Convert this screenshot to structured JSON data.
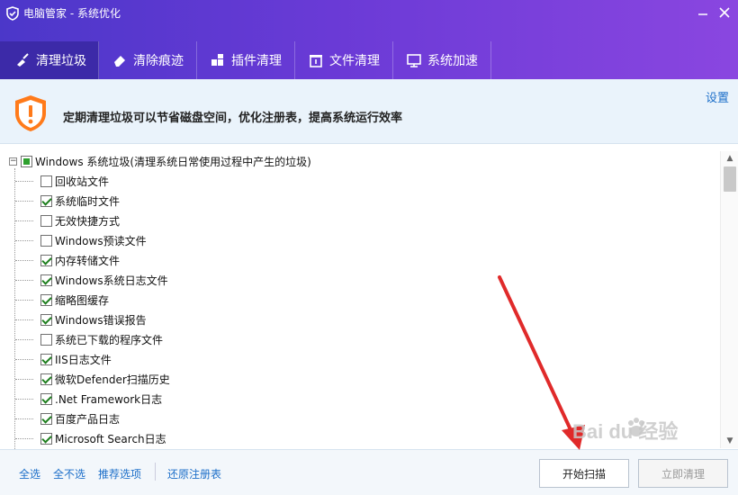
{
  "window": {
    "title": "电脑管家 - 系统优化"
  },
  "tabs": [
    {
      "label": "清理垃圾",
      "icon": "broom-icon",
      "active": true
    },
    {
      "label": "清除痕迹",
      "icon": "eraser-icon",
      "active": false
    },
    {
      "label": "插件清理",
      "icon": "puzzle-icon",
      "active": false
    },
    {
      "label": "文件清理",
      "icon": "file-box-icon",
      "active": false
    },
    {
      "label": "系统加速",
      "icon": "monitor-icon",
      "active": false
    }
  ],
  "banner": {
    "message": "定期清理垃圾可以节省磁盘空间，优化注册表，提高系统运行效率",
    "settings_label": "设置",
    "icon": "warning-shield-icon"
  },
  "tree": {
    "root": {
      "label": "Windows 系统垃圾(清理系统日常使用过程中产生的垃圾)",
      "state": "partial",
      "expanded": true
    },
    "items": [
      {
        "label": "回收站文件",
        "checked": false
      },
      {
        "label": "系统临时文件",
        "checked": true
      },
      {
        "label": "无效快捷方式",
        "checked": false
      },
      {
        "label": "Windows预读文件",
        "checked": false
      },
      {
        "label": "内存转储文件",
        "checked": true
      },
      {
        "label": "Windows系统日志文件",
        "checked": true
      },
      {
        "label": "缩略图缓存",
        "checked": true
      },
      {
        "label": "Windows错误报告",
        "checked": true
      },
      {
        "label": "系统已下载的程序文件",
        "checked": false
      },
      {
        "label": "IIS日志文件",
        "checked": true
      },
      {
        "label": "微软Defender扫描历史",
        "checked": true
      },
      {
        "label": ".Net Framework日志",
        "checked": true
      },
      {
        "label": "百度产品日志",
        "checked": true
      },
      {
        "label": "Microsoft Search日志",
        "checked": true
      }
    ]
  },
  "footer": {
    "select_all": "全选",
    "select_none": "全不选",
    "recommended": "推荐选项",
    "restore_registry": "还原注册表",
    "scan_button": "开始扫描",
    "clean_button": "立即清理"
  },
  "watermark": {
    "text": "Bai du 经验"
  },
  "colors": {
    "accent": "#5b3bd3",
    "link": "#1d6fc9",
    "arrow": "#e02a2a"
  }
}
